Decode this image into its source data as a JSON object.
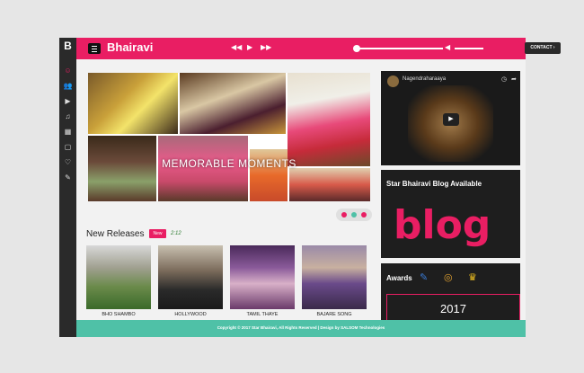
{
  "rail": {
    "logo": "B",
    "icons": [
      "smiley-icon",
      "users-icon",
      "play-icon",
      "music-note-icon",
      "grid-icon",
      "document-icon",
      "heart-icon",
      "pin-icon"
    ]
  },
  "header": {
    "brand": "Bhairavi",
    "contact_label": "CONTACT",
    "accent": "#e91e63"
  },
  "collage": {
    "caption": "MEMORABLE MOMENTS"
  },
  "new_releases": {
    "title": "New Releases",
    "badge": "New",
    "badge_text": "2:12",
    "items": [
      {
        "label": "BHO SHAMBO"
      },
      {
        "label": "HOLLYWOOD"
      },
      {
        "label": "TAMIL THAYE"
      },
      {
        "label": "BAJARE SONG"
      }
    ]
  },
  "video": {
    "title": "Nagendraharaaya"
  },
  "blog": {
    "title": "Star Bhairavi Blog Available",
    "logo_text": "blog"
  },
  "awards": {
    "title": "Awards",
    "year": "2017"
  },
  "footer": {
    "text": "Copyright © 2017 Star Bhairavi, All Rights Reserved | Design by SALSOM Technologies"
  }
}
